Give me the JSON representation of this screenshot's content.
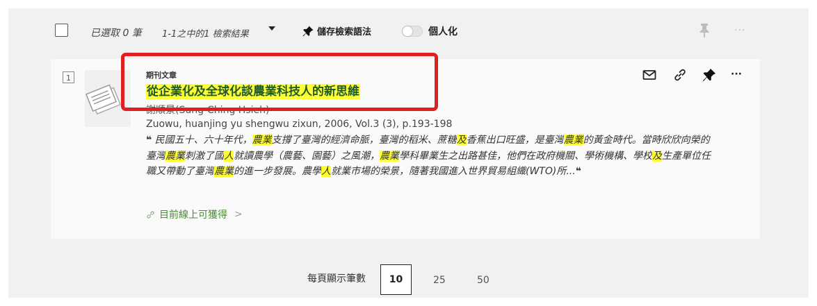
{
  "toolbar": {
    "selected_count": "已選取 0 筆",
    "result_count": "1-1之中的1 檢索結果",
    "save_query_label": "儲存檢索語法",
    "personalize_label": "個人化",
    "more_label": "···"
  },
  "result": {
    "index": "1",
    "doc_type": "期刊文章",
    "title": "從企業化及全球化談農業科技人的新思維",
    "authors": "謝順景(Sung-Ching Hsieh)",
    "source": "Zuowu, huanjing yu shengwu zixun, 2006, Vol.3 (3), p.193-198",
    "abstract_segments": [
      {
        "t": "民國五十、六十年代，",
        "h": false
      },
      {
        "t": "農業",
        "h": true
      },
      {
        "t": "支撐了臺灣的經濟命脈，臺灣的稻米、蔗糖",
        "h": false
      },
      {
        "t": "及",
        "h": true
      },
      {
        "t": "香蕉出口旺盛，是臺灣",
        "h": false
      },
      {
        "t": "農業",
        "h": true
      },
      {
        "t": "的黃金時代。當時欣欣向榮的臺灣",
        "h": false
      },
      {
        "t": "農業",
        "h": true
      },
      {
        "t": "刺激了國",
        "h": false
      },
      {
        "t": "人",
        "h": true
      },
      {
        "t": "就讀農學（農藝、園藝）之風潮，",
        "h": false
      },
      {
        "t": "農業",
        "h": true
      },
      {
        "t": "學科畢業生之出路甚佳，他們在政府機關、學術機構、學校",
        "h": false
      },
      {
        "t": "及",
        "h": true
      },
      {
        "t": "生產單位任職又帶動了臺灣",
        "h": false
      },
      {
        "t": "農業",
        "h": true
      },
      {
        "t": "的進一步發展。農學",
        "h": false
      },
      {
        "t": "人",
        "h": true
      },
      {
        "t": "就業市場的榮景，隨著我國進入世界貿易組織(WTO)所...",
        "h": false
      }
    ],
    "quote_mark": "❝",
    "availability": "目前線上可獲得",
    "availability_chevron": ">",
    "more_label": "···"
  },
  "pager": {
    "per_page_label": "每頁顯示筆數",
    "options": [
      "10",
      "25",
      "50"
    ],
    "selected": "10"
  },
  "colors": {
    "highlight": "#ffff33",
    "title_text": "#1d5b2e",
    "annotation_box": "#e02020",
    "availability": "#4a8a3a"
  }
}
